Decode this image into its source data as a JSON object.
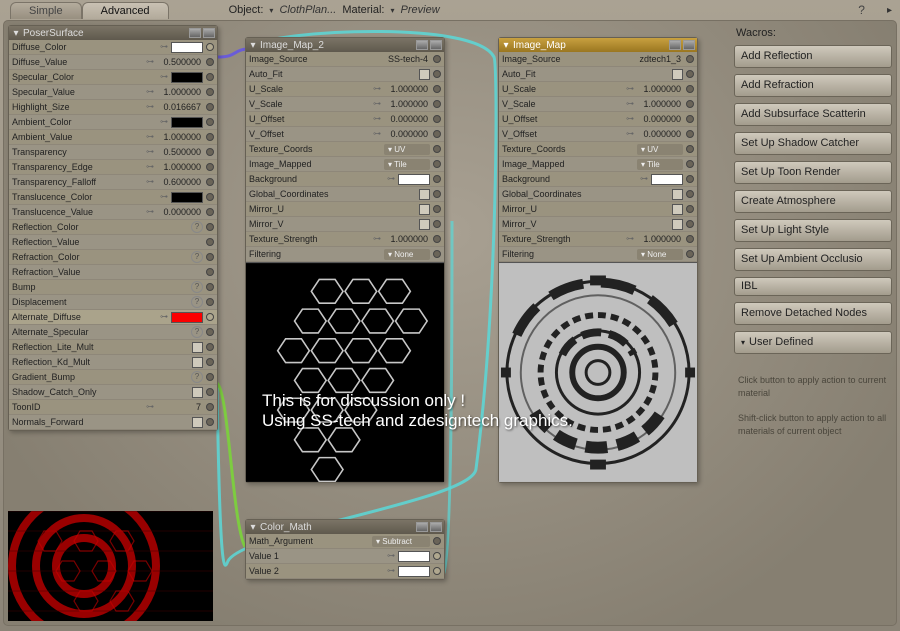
{
  "tabs": {
    "simple": "Simple",
    "advanced": "Advanced"
  },
  "topinfo": {
    "object_label": "Object:",
    "object_value": "ClothPlan...",
    "material_label": "Material:",
    "preview_label": "Preview"
  },
  "help_glyph": "?",
  "poser": {
    "title": "PoserSurface",
    "rows": {
      "diffuse_color": "Diffuse_Color",
      "diffuse_value": "Diffuse_Value",
      "diffuse_value_v": "0.500000",
      "specular_color": "Specular_Color",
      "specular_value": "Specular_Value",
      "specular_value_v": "1.000000",
      "highlight_size": "Highlight_Size",
      "highlight_size_v": "0.016667",
      "ambient_color": "Ambient_Color",
      "ambient_value": "Ambient_Value",
      "ambient_value_v": "1.000000",
      "transparency": "Transparency",
      "transparency_v": "0.500000",
      "transparency_edge": "Transparency_Edge",
      "transparency_edge_v": "1.000000",
      "transparency_falloff": "Transparency_Falloff",
      "transparency_falloff_v": "0.600000",
      "translucence_color": "Translucence_Color",
      "translucence_value": "Translucence_Value",
      "translucence_value_v": "0.000000",
      "reflection_color": "Reflection_Color",
      "reflection_value": "Reflection_Value",
      "refraction_color": "Refraction_Color",
      "refraction_value": "Refraction_Value",
      "bump": "Bump",
      "displacement": "Displacement",
      "alternate_diffuse": "Alternate_Diffuse",
      "alternate_specular": "Alternate_Specular",
      "reflection_lite_mult": "Reflection_Lite_Mult",
      "reflection_kd_mult": "Reflection_Kd_Mult",
      "gradient_bump": "Gradient_Bump",
      "shadow_catch_only": "Shadow_Catch_Only",
      "toonid": "ToonID",
      "toonid_v": "7",
      "normals_forward": "Normals_Forward"
    }
  },
  "image_map2": {
    "title": "Image_Map_2",
    "rows": {
      "image_source": "Image_Source",
      "image_source_v": "SS-tech-4",
      "auto_fit": "Auto_Fit",
      "u_scale": "U_Scale",
      "u_scale_v": "1.000000",
      "v_scale": "V_Scale",
      "v_scale_v": "1.000000",
      "u_offset": "U_Offset",
      "u_offset_v": "0.000000",
      "v_offset": "V_Offset",
      "v_offset_v": "0.000000",
      "texture_coords": "Texture_Coords",
      "texture_coords_v": "▾ UV",
      "image_mapped": "Image_Mapped",
      "image_mapped_v": "▾ Tile",
      "background": "Background",
      "global_coordinates": "Global_Coordinates",
      "mirror_u": "Mirror_U",
      "mirror_v": "Mirror_V",
      "texture_strength": "Texture_Strength",
      "texture_strength_v": "1.000000",
      "filtering": "Filtering",
      "filtering_v": "▾ None"
    }
  },
  "image_map": {
    "title": "Image_Map",
    "rows": {
      "image_source": "Image_Source",
      "image_source_v": "zdtech1_3",
      "auto_fit": "Auto_Fit",
      "u_scale": "U_Scale",
      "u_scale_v": "1.000000",
      "v_scale": "V_Scale",
      "v_scale_v": "1.000000",
      "u_offset": "U_Offset",
      "u_offset_v": "0.000000",
      "v_offset": "V_Offset",
      "v_offset_v": "0.000000",
      "texture_coords": "Texture_Coords",
      "texture_coords_v": "▾ UV",
      "image_mapped": "Image_Mapped",
      "image_mapped_v": "▾ Tile",
      "background": "Background",
      "global_coordinates": "Global_Coordinates",
      "mirror_u": "Mirror_U",
      "mirror_v": "Mirror_V",
      "texture_strength": "Texture_Strength",
      "texture_strength_v": "1.000000",
      "filtering": "Filtering",
      "filtering_v": "▾ None"
    }
  },
  "color_math": {
    "title": "Color_Math",
    "rows": {
      "math_argument": "Math_Argument",
      "math_argument_v": "▾ Subtract",
      "value1": "Value 1",
      "value2": "Value 2"
    }
  },
  "wacros": {
    "title": "Wacros:",
    "buttons": {
      "add_reflection": "Add Reflection",
      "add_refraction": "Add Refraction",
      "add_sss": "Add Subsurface Scatterin",
      "shadow_catcher": "Set Up Shadow Catcher",
      "toon_render": "Set Up Toon Render",
      "create_atmosphere": "Create Atmosphere",
      "light_style": "Set Up Light Style",
      "ambient_occlusion": "Set Up Ambient Occlusio",
      "ibl": "IBL",
      "remove_detached": "Remove Detached Nodes",
      "user_defined": "User Defined"
    },
    "hint1": "Click button to apply action to current material",
    "hint2": "Shift-click button to apply action to all materials of current object"
  },
  "overlay": {
    "line1": "This is for discussion only !",
    "line2": "Using SS-tech and zdesigntech graphics."
  },
  "key_glyph": "⊶"
}
